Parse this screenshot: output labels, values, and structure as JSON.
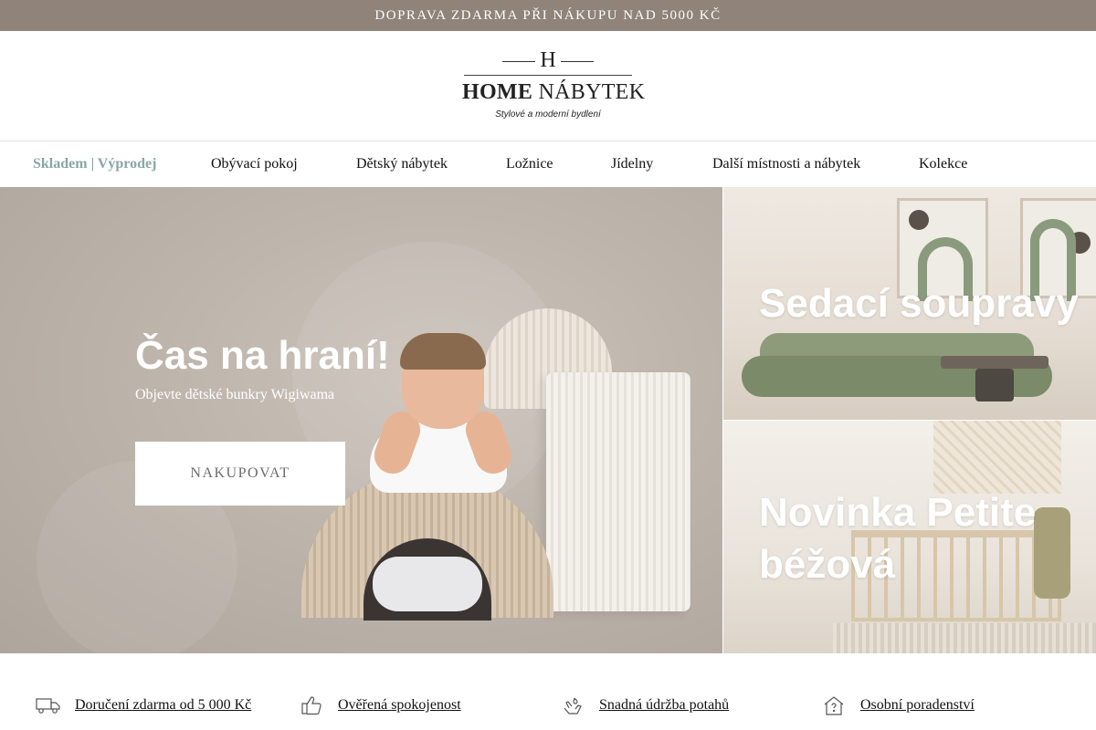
{
  "topbar": {
    "text": "DOPRAVA ZDARMA PŘI NÁKUPU NAD 5000 KČ"
  },
  "logo": {
    "letter": "H",
    "name_bold": "HOME",
    "name_regular": "NÁBYTEK",
    "tagline": "Stylové a moderní bydlení"
  },
  "nav": {
    "promo": " Skladem |  Výprodej",
    "items": [
      "Obývací pokoj",
      "Dětský nábytek",
      "Ložnice",
      "Jídelny",
      "Další místnosti a nábytek",
      "Kolekce"
    ]
  },
  "hero": {
    "title": "Čas na hraní!",
    "subtitle": "Objevte dětské bunkry Wigiwama",
    "button": "NAKUPOVAT"
  },
  "tiles": [
    {
      "title": "Sedací soupravy"
    },
    {
      "title": "Novinka Petite béžová"
    }
  ],
  "features": [
    {
      "icon": "truck-icon",
      "label": "Doručení zdarma od 5 000 Kč"
    },
    {
      "icon": "thumbs-up-icon",
      "label": "Ověřená spokojenost"
    },
    {
      "icon": "hand-care-icon",
      "label": "Snadná údržba potahů"
    },
    {
      "icon": "house-question-icon",
      "label": "Osobní poradenství"
    }
  ],
  "colors": {
    "topbar": "#8f837a",
    "promo": "#8aa7a0",
    "hero_bg": "#bdb4ab"
  }
}
